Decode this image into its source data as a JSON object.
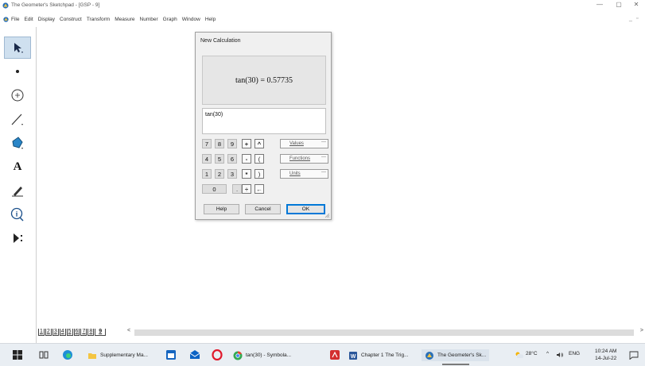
{
  "window": {
    "title": "The Geometer's Sketchpad - [GSP - 9]",
    "controls": {
      "minimize": "—",
      "maximize": "▢",
      "close": "✕"
    },
    "doc_controls": {
      "minimize": "_",
      "restore": "▫"
    }
  },
  "menu": {
    "items": [
      "File",
      "Edit",
      "Display",
      "Construct",
      "Transform",
      "Measure",
      "Number",
      "Graph",
      "Window",
      "Help"
    ]
  },
  "toolbox": {
    "tools": [
      {
        "name": "arrow-tool",
        "selected": true
      },
      {
        "name": "point-tool"
      },
      {
        "name": "compass-tool"
      },
      {
        "name": "straightedge-tool"
      },
      {
        "name": "polygon-tool"
      },
      {
        "name": "text-tool",
        "glyph": "A"
      },
      {
        "name": "marker-tool"
      },
      {
        "name": "information-tool"
      },
      {
        "name": "custom-tool"
      }
    ]
  },
  "pages": {
    "tabs": [
      "1",
      "2",
      "3",
      "4",
      "5",
      "6",
      "7",
      "8",
      "9"
    ],
    "active": "9",
    "left_arrow": "<",
    "right_arrow": ">"
  },
  "dialog": {
    "title": "New Calculation",
    "result": "tan(30) = 0.57735",
    "expression": "tan(30)",
    "keypad": {
      "digits": [
        [
          "7",
          "8",
          "9"
        ],
        [
          "4",
          "5",
          "6"
        ],
        [
          "1",
          "2",
          "3"
        ]
      ],
      "ops": [
        "+",
        "-",
        "*",
        "÷"
      ],
      "extras": [
        "^",
        "(",
        ")",
        "←"
      ],
      "zero": "0",
      "dot": "."
    },
    "menus": {
      "values": "Values",
      "functions": "Functions",
      "units": "Units"
    },
    "menu_arrow": "—",
    "buttons": {
      "help": "Help",
      "cancel": "Cancel",
      "ok": "OK"
    }
  },
  "taskbar": {
    "apps": [
      {
        "label": "Supplementary Ma...",
        "icon": "folder-icon"
      },
      {
        "label": "tan(30) - Symbola...",
        "icon": "chrome-icon"
      },
      {
        "label": "Chapter 1 The Trig...",
        "icon": "word-icon"
      },
      {
        "label": "The Geometer's Sk...",
        "icon": "sketchpad-icon",
        "active": true
      }
    ],
    "weather": "28°C",
    "tray_chevron": "^",
    "volume_icon": "speaker-icon",
    "language": "ENG",
    "time": "10:24 AM",
    "date": "14-Jul-22"
  },
  "colors": {
    "accent": "#0078d7",
    "toolbox_selected": "#cfe0ef",
    "taskbar_bg": "#e9eef3"
  }
}
